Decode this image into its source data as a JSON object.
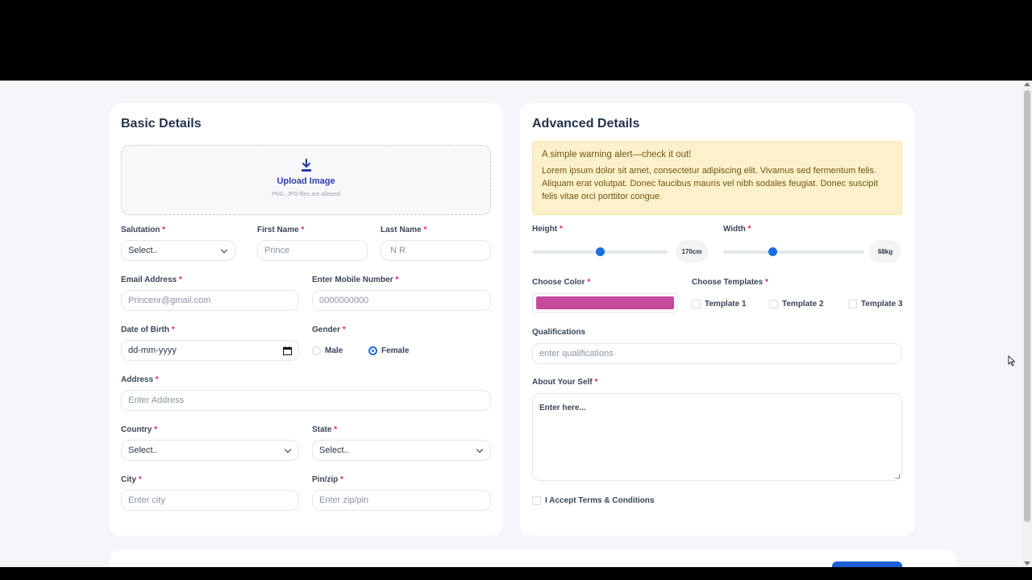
{
  "basic": {
    "title": "Basic Details",
    "upload": {
      "label": "Upload Image",
      "hint": "PNG, JPG files are allowed"
    },
    "salutation": {
      "label": "Salutation",
      "value": "Select.."
    },
    "first_name": {
      "label": "First Name",
      "placeholder": "Prince"
    },
    "last_name": {
      "label": "Last Name",
      "placeholder": "N R"
    },
    "email": {
      "label": "Email Address",
      "placeholder": "Princenr@gmail.com"
    },
    "mobile": {
      "label": "Enter Mobile Number",
      "placeholder": "0000000000"
    },
    "dob": {
      "label": "Date of Birth",
      "value": "dd-mm-yyyy"
    },
    "gender": {
      "label": "Gender",
      "options": [
        "Male",
        "Female"
      ],
      "selected": "Female"
    },
    "address": {
      "label": "Address",
      "placeholder": "Enter Address"
    },
    "country": {
      "label": "Country",
      "value": "Select.."
    },
    "state": {
      "label": "State",
      "value": "Select.."
    },
    "city": {
      "label": "City",
      "placeholder": "Enter city"
    },
    "pin": {
      "label": "Pin/zip",
      "placeholder": "Enter zip/pin"
    },
    "required_mark": "*"
  },
  "advanced": {
    "title": "Advanced Details",
    "alert": {
      "title": "A simple warning alert—check it out!",
      "body": "Lorem ipsum dolor sit amet, consectetur adipiscing elit. Vivamus sed fermentum felis. Aliquam erat volutpat. Donec faucibus mauris vel nibh sodales feugiat. Donec suscipit felis vitae orci porttitor congue."
    },
    "height": {
      "label": "Height",
      "value": "170cm",
      "fraction": 0.5
    },
    "width": {
      "label": "Width",
      "value": "68kg",
      "fraction": 0.35
    },
    "color": {
      "label": "Choose Color",
      "value": "#c64a9c"
    },
    "templates": {
      "label": "Choose Templates",
      "options": [
        "Template 1",
        "Template 2",
        "Template 3"
      ]
    },
    "qualifications": {
      "label": "Qualifications",
      "placeholder": "enter qualifications"
    },
    "about": {
      "label": "About Your Self",
      "placeholder": "Enter here..."
    },
    "terms": {
      "label": "I Accept Terms & Conditions"
    }
  },
  "colors": {
    "accent": "#1a6fe0",
    "required": "#e0245e",
    "alert_bg": "#fdf1cb"
  }
}
